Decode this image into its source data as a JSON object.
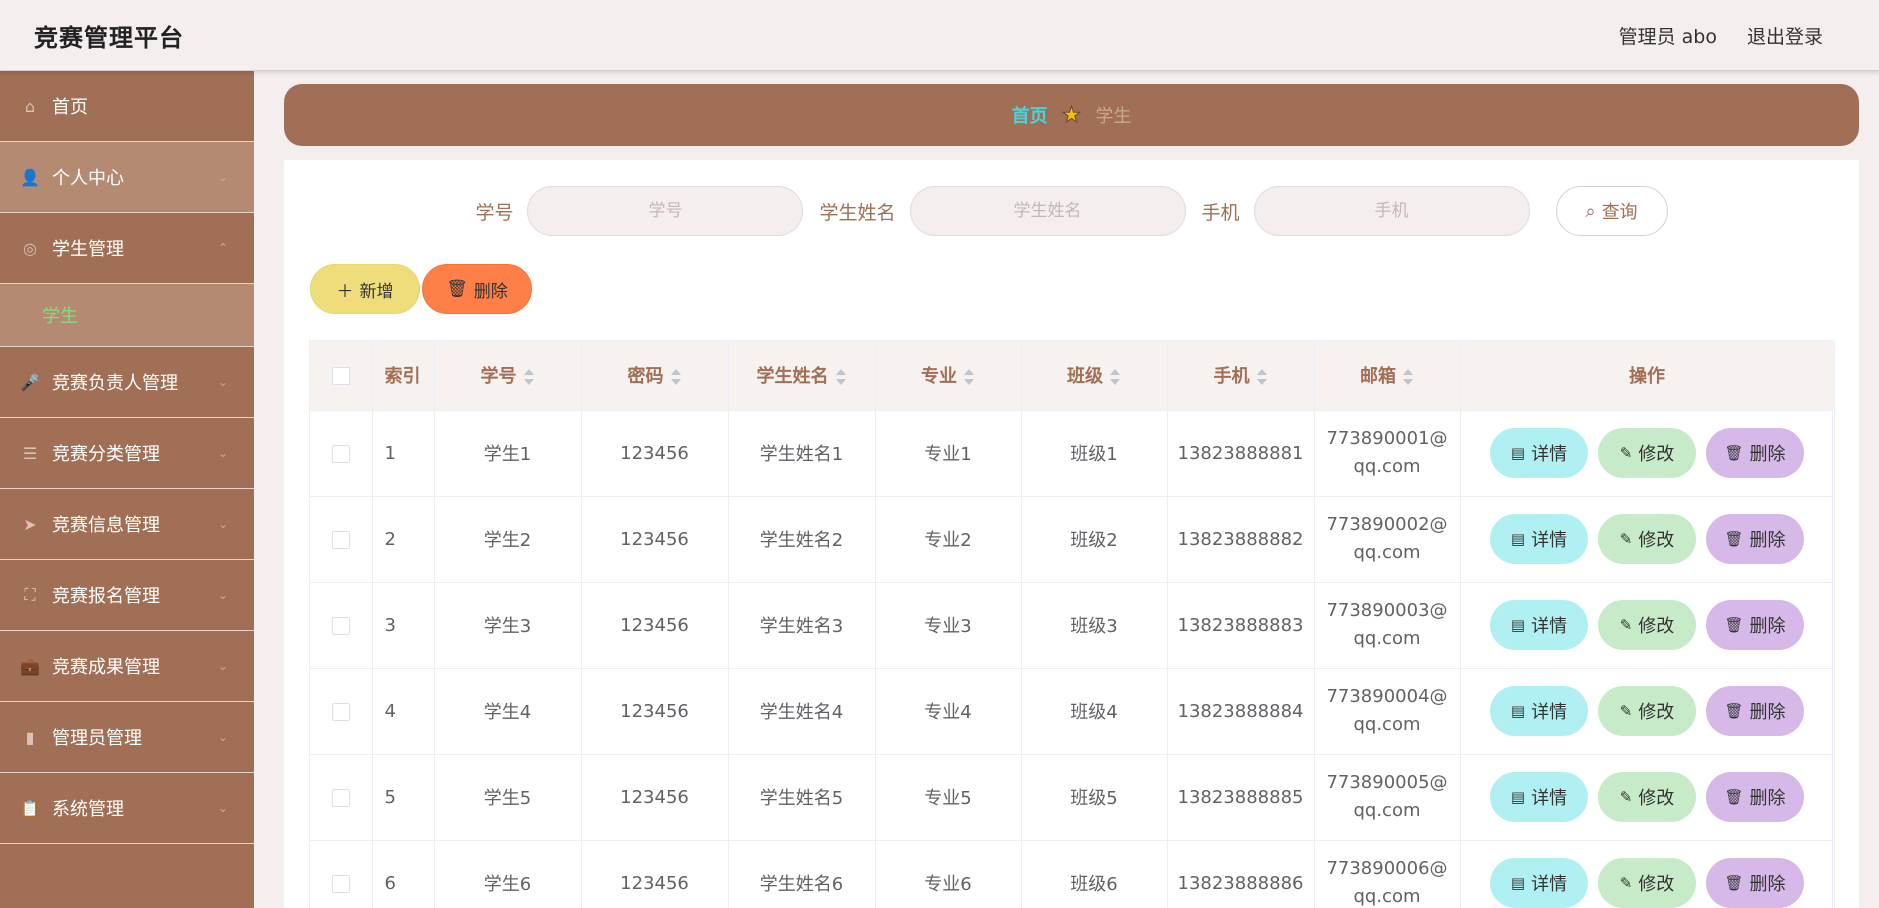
{
  "header": {
    "title": "竞赛管理平台",
    "user": "管理员 abo",
    "logout": "退出登录"
  },
  "sidebar": {
    "items": [
      {
        "label": "首页",
        "icon": "home-icon",
        "glyph": "⌂"
      },
      {
        "label": "个人中心",
        "icon": "user-icon",
        "glyph": "👤"
      },
      {
        "label": "学生管理",
        "icon": "lifebuoy-icon",
        "glyph": "◎"
      },
      {
        "label": "竞赛负责人管理",
        "icon": "microphone-icon",
        "glyph": "🎤"
      },
      {
        "label": "竞赛分类管理",
        "icon": "sliders-icon",
        "glyph": "☰"
      },
      {
        "label": "竞赛信息管理",
        "icon": "paper-plane-icon",
        "glyph": "➤"
      },
      {
        "label": "竞赛报名管理",
        "icon": "fullscreen-icon",
        "glyph": "⛶"
      },
      {
        "label": "竞赛成果管理",
        "icon": "briefcase-icon",
        "glyph": "💼"
      },
      {
        "label": "管理员管理",
        "icon": "notebook-icon",
        "glyph": "▮"
      },
      {
        "label": "系统管理",
        "icon": "clipboard-icon",
        "glyph": "📋"
      }
    ],
    "sub_item": "学生"
  },
  "breadcrumb": {
    "home": "首页",
    "current": "学生"
  },
  "search": {
    "id_label": "学号",
    "id_placeholder": "学号",
    "name_label": "学生姓名",
    "name_placeholder": "学生姓名",
    "phone_label": "手机",
    "phone_placeholder": "手机",
    "query": "查询"
  },
  "actions": {
    "add": "新增",
    "delete": "删除"
  },
  "table": {
    "headers": {
      "index": "索引",
      "student_id": "学号",
      "password": "密码",
      "name": "学生姓名",
      "major": "专业",
      "class": "班级",
      "phone": "手机",
      "email": "邮箱",
      "ops": "操作"
    },
    "ops": {
      "detail": "详情",
      "edit": "修改",
      "delete": "删除"
    },
    "rows": [
      {
        "index": "1",
        "student_id": "学生1",
        "password": "123456",
        "name": "学生姓名1",
        "major": "专业1",
        "class": "班级1",
        "phone": "13823888881",
        "email_a": "773890001@",
        "email_b": "qq.com"
      },
      {
        "index": "2",
        "student_id": "学生2",
        "password": "123456",
        "name": "学生姓名2",
        "major": "专业2",
        "class": "班级2",
        "phone": "13823888882",
        "email_a": "773890002@",
        "email_b": "qq.com"
      },
      {
        "index": "3",
        "student_id": "学生3",
        "password": "123456",
        "name": "学生姓名3",
        "major": "专业3",
        "class": "班级3",
        "phone": "13823888883",
        "email_a": "773890003@",
        "email_b": "qq.com"
      },
      {
        "index": "4",
        "student_id": "学生4",
        "password": "123456",
        "name": "学生姓名4",
        "major": "专业4",
        "class": "班级4",
        "phone": "13823888884",
        "email_a": "773890004@",
        "email_b": "qq.com"
      },
      {
        "index": "5",
        "student_id": "学生5",
        "password": "123456",
        "name": "学生姓名5",
        "major": "专业5",
        "class": "班级5",
        "phone": "13823888885",
        "email_a": "773890005@",
        "email_b": "qq.com"
      },
      {
        "index": "6",
        "student_id": "学生6",
        "password": "123456",
        "name": "学生姓名6",
        "major": "专业6",
        "class": "班级6",
        "phone": "13823888886",
        "email_a": "773890006@",
        "email_b": "qq.com"
      }
    ]
  },
  "colors": {
    "brand": "#a06f55",
    "background": "#f5eeee",
    "active_sub": "#7fe07a",
    "breadcrumb_home": "#49d3e0",
    "add_button": "#efdd7c",
    "delete_button": "#ff7f48",
    "detail_button": "#b1f0f2",
    "edit_button": "#c7ebc8",
    "row_delete_button": "#d6b9e8"
  }
}
